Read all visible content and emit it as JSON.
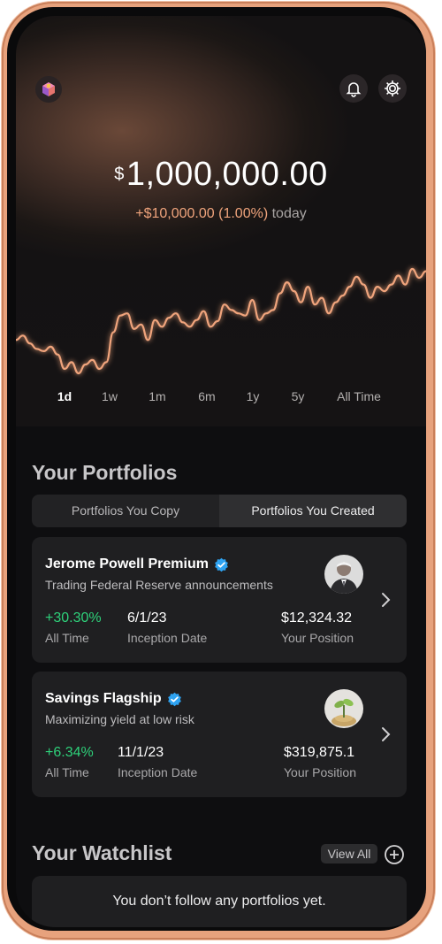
{
  "header": {
    "logo_icon": "cube-logo-icon",
    "notifications_icon": "bell-icon",
    "settings_icon": "gear-icon"
  },
  "balance": {
    "currency": "$",
    "amount": "1,000,000.00",
    "change": "+$10,000.00 (1.00%)",
    "period": "today"
  },
  "chart_data": {
    "type": "line",
    "title": "",
    "series": [
      {
        "values": [
          48,
          52,
          45,
          40,
          38,
          42,
          35,
          22,
          28,
          18,
          26,
          30,
          22,
          28,
          55,
          70,
          72,
          58,
          62,
          48,
          66,
          60,
          68,
          72,
          64,
          60,
          66,
          74,
          60,
          65,
          80,
          75,
          72,
          70,
          84,
          66,
          72,
          75,
          90,
          100,
          92,
          82,
          96,
          80,
          86,
          72,
          82,
          88,
          96,
          105,
          98,
          86,
          96,
          92,
          98,
          106,
          98,
          112,
          104,
          110
        ]
      }
    ],
    "color": "#f0a47c"
  },
  "time_ranges": {
    "items": [
      "1d",
      "1w",
      "1m",
      "6m",
      "1y",
      "5y",
      "All Time"
    ],
    "active": "1d"
  },
  "portfolios": {
    "title": "Your Portfolios",
    "tabs": [
      "Portfolios You Copy",
      "Portfolios You Created"
    ],
    "active_tab": "Portfolios You Created",
    "cards": [
      {
        "name": "Jerome Powell Premium",
        "description": "Trading Federal Reserve announcements",
        "return_value": "+30.30%",
        "return_label": "All Time",
        "inception_value": "6/1/23",
        "inception_label": "Inception Date",
        "position_value": "$12,324.32",
        "position_label": "Your Position",
        "verified_icon": "verified-badge-icon",
        "avatar_icon": "person-avatar-icon"
      },
      {
        "name": "Savings Flagship",
        "description": "Maximizing yield at low risk",
        "return_value": "+6.34%",
        "return_label": "All Time",
        "inception_value": "11/1/23",
        "inception_label": "Inception Date",
        "position_value": "$319,875.1",
        "position_label": "Your Position",
        "verified_icon": "verified-badge-icon",
        "avatar_icon": "plant-avatar-icon"
      }
    ]
  },
  "watchlist": {
    "title": "Your Watchlist",
    "view_all": "View All",
    "add_icon": "plus-circle-icon",
    "empty_message": "You don’t follow any portfolios yet."
  }
}
